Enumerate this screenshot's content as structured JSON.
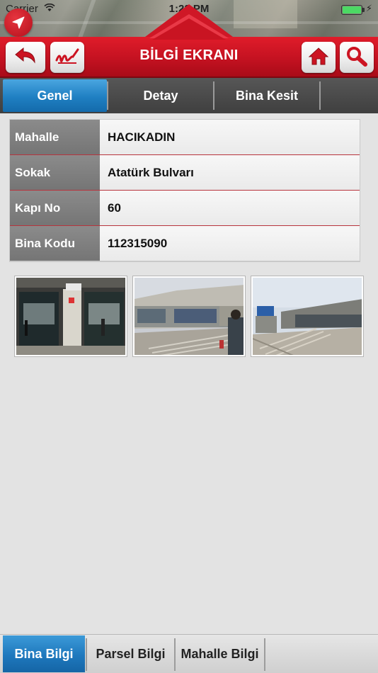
{
  "status": {
    "carrier": "Carrier",
    "time": "1:22 PM"
  },
  "header": {
    "title": "BİLGİ EKRANI"
  },
  "icons": {
    "navigate": "location-arrow-icon",
    "back": "back-arrow-icon",
    "signature": "signature-icon",
    "home": "home-icon",
    "search": "search-icon"
  },
  "colors": {
    "header_red": "#c41221",
    "tab_active_blue": "#1f7fc2",
    "row_divider": "#b7343d"
  },
  "tabs": [
    {
      "label": "Genel",
      "active": true
    },
    {
      "label": "Detay",
      "active": false
    },
    {
      "label": "Bina Kesit",
      "active": false
    }
  ],
  "info": [
    {
      "label": "Mahalle",
      "value": "HACIKADIN"
    },
    {
      "label": "Sokak",
      "value": "Atatürk Bulvarı"
    },
    {
      "label": "Kapı No",
      "value": "60"
    },
    {
      "label": "Bina Kodu",
      "value": "112315090"
    }
  ],
  "bottom_tabs": [
    {
      "label": "Bina Bilgi",
      "active": true
    },
    {
      "label": "Parsel Bilgi",
      "active": false
    },
    {
      "label": "Mahalle Bilgi",
      "active": false
    }
  ]
}
